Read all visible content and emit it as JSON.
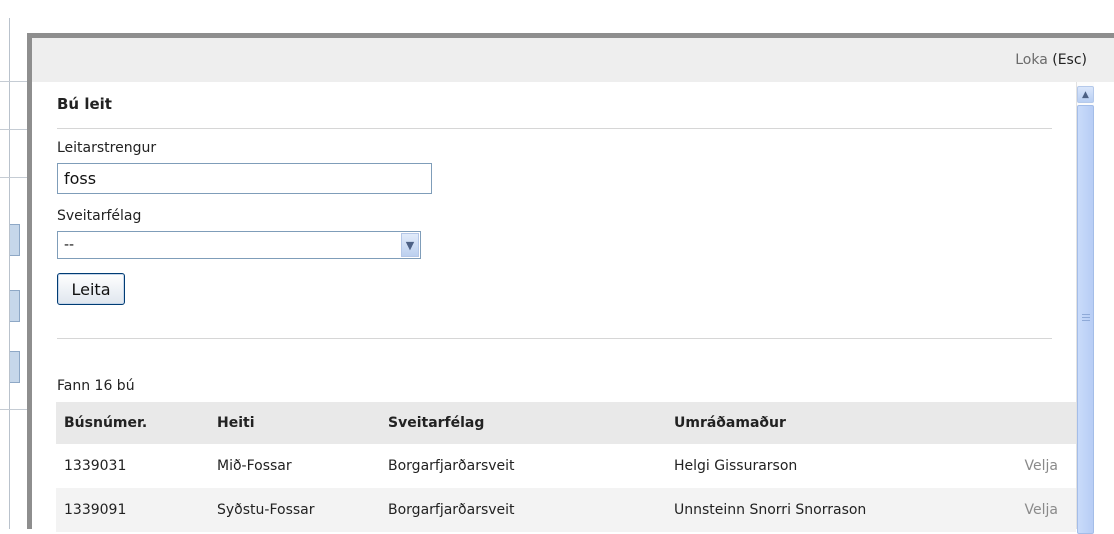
{
  "modal": {
    "close_label": "Loka",
    "close_key": "(Esc)",
    "title": "Bú leit",
    "search_label": "Leitarstrengur",
    "search_value": "foss",
    "municipality_label": "Sveitarfélag",
    "municipality_selected": "--",
    "search_button": "Leita",
    "result_count": "Fann 16 bú",
    "table": {
      "headers": [
        "Búsnúmer.",
        "Heiti",
        "Sveitarfélag",
        "Umráðamaður",
        ""
      ],
      "rows": [
        {
          "number": "1339031",
          "name": "Mið-Fossar",
          "municipality": "Borgarfjarðarsveit",
          "manager": "Helgi Gissurarson",
          "action": "Velja"
        },
        {
          "number": "1339091",
          "name": "Syðstu-Fossar",
          "municipality": "Borgarfjarðarsveit",
          "manager": "Unnsteinn Snorri Snorrason",
          "action": "Velja"
        }
      ]
    }
  },
  "icons": {
    "select_arrow": "chevron-down-icon",
    "scroll_up": "chevron-up-icon"
  },
  "colors": {
    "modal_border": "#8e8e8e",
    "header_bg": "#eeeeee",
    "table_header_bg": "#e9e9e9",
    "input_border": "#7f9db9",
    "button_border": "#003c74"
  }
}
